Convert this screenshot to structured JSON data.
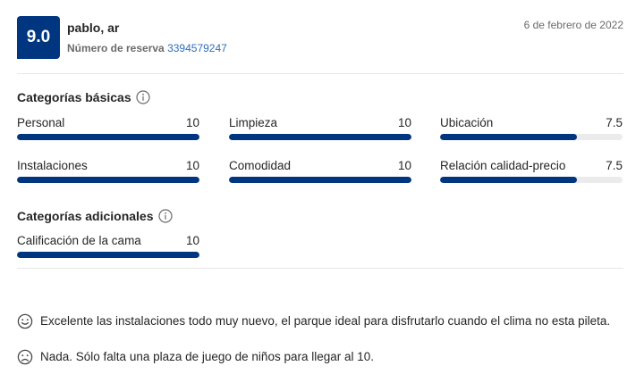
{
  "review": {
    "score": "9.0",
    "reviewer": "pablo, ar",
    "booking_label": "Número de reserva",
    "booking_number": "3394579247",
    "date": "6 de febrero de 2022"
  },
  "basic": {
    "title": "Categorías básicas",
    "items": [
      {
        "label": "Personal",
        "score": "10",
        "value": 10
      },
      {
        "label": "Limpieza",
        "score": "10",
        "value": 10
      },
      {
        "label": "Ubicación",
        "score": "7.5",
        "value": 7.5
      },
      {
        "label": "Instalaciones",
        "score": "10",
        "value": 10
      },
      {
        "label": "Comodidad",
        "score": "10",
        "value": 10
      },
      {
        "label": "Relación calidad-precio",
        "score": "7.5",
        "value": 7.5
      }
    ]
  },
  "additional": {
    "title": "Categorías adicionales",
    "items": [
      {
        "label": "Calificación de la cama",
        "score": "10",
        "value": 10
      }
    ]
  },
  "comments": {
    "positive": "Excelente las instalaciones todo muy nuevo, el parque ideal para disfrutarlo cuando el clima no esta pileta.",
    "negative": "Nada. Sólo falta una plaza de juego de niños para llegar al 10."
  },
  "colors": {
    "accent": "#003580",
    "link": "#2e6fba",
    "bar_track": "#ebebeb"
  },
  "icons": {
    "info": "info-circle-icon",
    "positive": "smile-face-icon",
    "negative": "frown-face-icon"
  }
}
